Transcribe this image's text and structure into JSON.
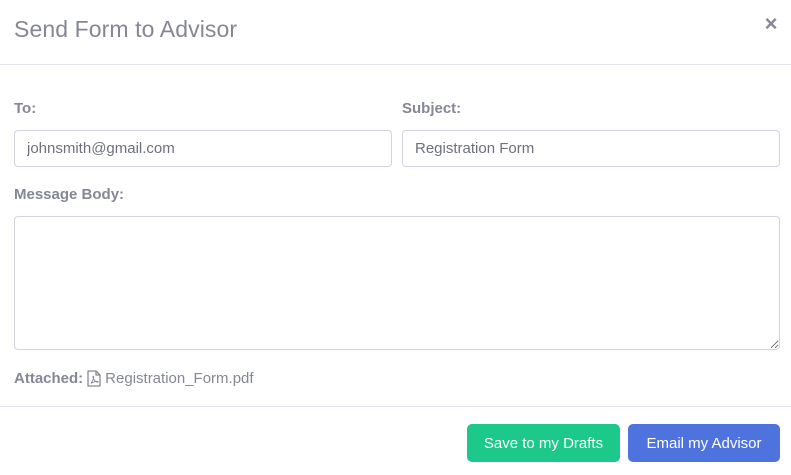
{
  "modal": {
    "title": "Send Form to Advisor",
    "close_symbol": "×"
  },
  "form": {
    "to_label": "To:",
    "to_value": "johnsmith@gmail.com",
    "subject_label": "Subject:",
    "subject_value": "Registration Form",
    "message_label": "Message Body:",
    "message_value": ""
  },
  "attachment": {
    "label": "Attached:",
    "icon": "file-pdf-icon",
    "file_name": "Registration_Form.pdf"
  },
  "footer": {
    "drafts_label": "Save to my Drafts",
    "email_label": "Email my Advisor"
  },
  "colors": {
    "drafts_button": "#1cc88a",
    "email_button": "#4e73df",
    "text": "#858796"
  }
}
